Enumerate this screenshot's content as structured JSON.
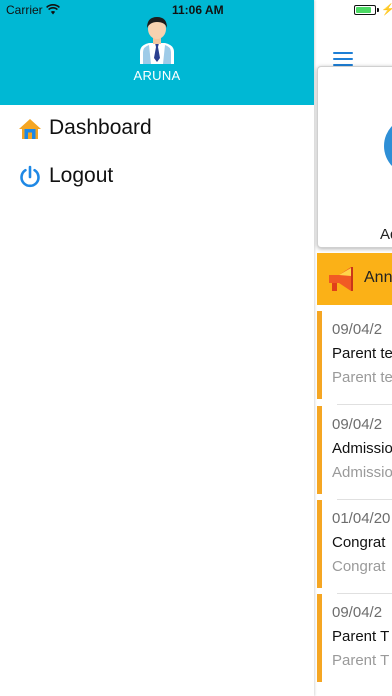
{
  "status_bar": {
    "carrier": "Carrier",
    "time": "11:06 AM",
    "battery_level": 0.85,
    "icons": [
      "wifi-icon",
      "battery-icon",
      "charging-icon"
    ]
  },
  "drawer": {
    "header_color": "#00b8d4",
    "username": "ARUNA",
    "avatar_icon": "user-avatar-icon",
    "menu": [
      {
        "label": "Dashboard",
        "icon": "home-icon"
      },
      {
        "label": "Logout",
        "icon": "power-icon"
      }
    ]
  },
  "background": {
    "menu_icon": "hamburger-icon",
    "admin_card_label": "Ad",
    "announcement_header": "Ann",
    "announcement_color": "#fbb117",
    "announcements": [
      {
        "date": "09/04/2",
        "title": "Parent te",
        "desc": "Parent te"
      },
      {
        "date": "09/04/2",
        "title": "Admissio",
        "desc": "Admissio"
      },
      {
        "date": "01/04/20",
        "title": "Congrat",
        "desc": "Congrat"
      },
      {
        "date": "09/04/2",
        "title": "Parent T",
        "desc": "Parent T"
      }
    ]
  }
}
